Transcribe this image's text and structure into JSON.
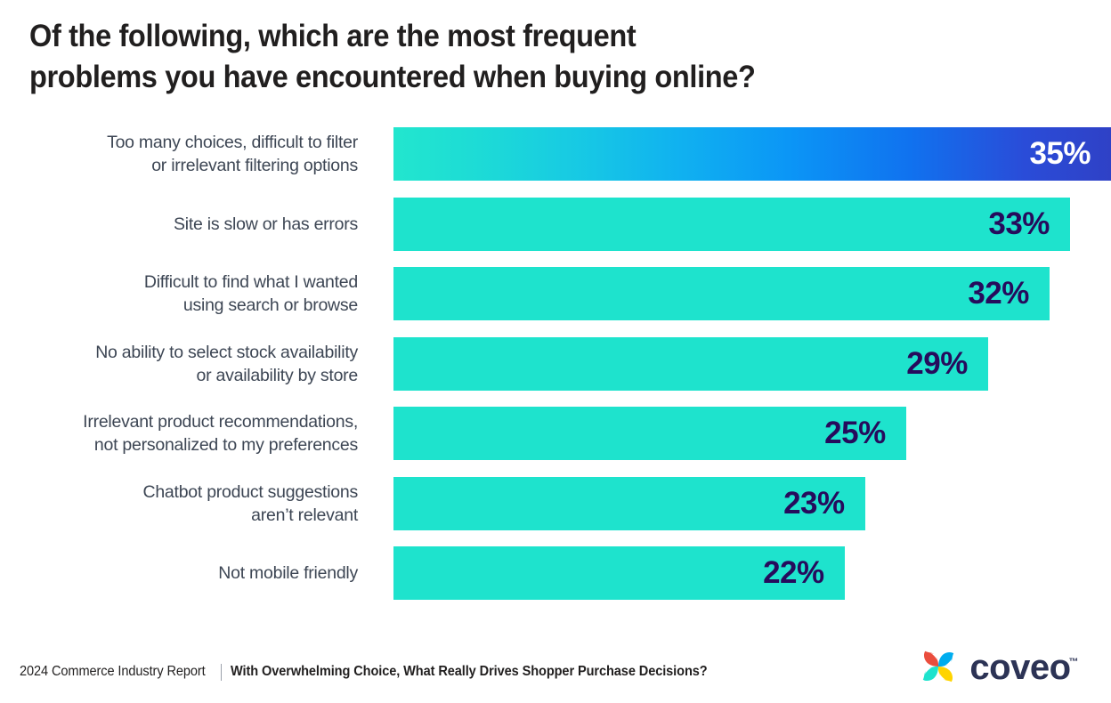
{
  "title": "Of the following, which are the most frequent\nproblems you have encountered when buying online?",
  "footer": {
    "report": "2024 Commerce Industry Report",
    "subtitle": "With Overwhelming Choice, What Really Drives Shopper Purchase Decisions?"
  },
  "logo": {
    "wordmark": "coveo",
    "tm": "™",
    "mark_colors": {
      "top_left": "#ea4d3d",
      "top_right": "#00adef",
      "bottom_left": "#1ee3cd",
      "bottom_right": "#ffd400"
    }
  },
  "colors": {
    "bar_teal": "#1ee3cd",
    "bar_gradient_start": "#22e6ce",
    "bar_gradient_mid": "#0b96f6",
    "bar_gradient_end": "#2f41c6",
    "value_text_dark": "#260b5c",
    "value_text_light": "#ffffff",
    "label_text": "#3d4654",
    "title_text": "#211f1f"
  },
  "chart_data": {
    "type": "bar",
    "orientation": "horizontal",
    "title": "Of the following, which are the most frequent problems you have encountered when buying online?",
    "xlabel": "",
    "ylabel": "",
    "xlim": [
      0,
      35
    ],
    "grid": false,
    "legend": null,
    "value_suffix": "%",
    "categories": [
      "Too many choices, difficult to filter\nor irrelevant filtering options",
      "Site is slow or has errors",
      "Difficult to find what I wanted\nusing search or browse",
      "No ability to select stock availability\nor availability by store",
      "Irrelevant product recommendations,\nnot personalized to my preferences",
      "Chatbot product suggestions\naren’t relevant",
      "Not mobile friendly"
    ],
    "values": [
      35,
      33,
      32,
      29,
      25,
      23,
      22
    ],
    "value_labels": [
      "35%",
      "33%",
      "32%",
      "29%",
      "25%",
      "23%",
      "22%"
    ],
    "bar_styles": [
      "gradient",
      "solid",
      "solid",
      "solid",
      "solid",
      "solid",
      "solid"
    ]
  }
}
